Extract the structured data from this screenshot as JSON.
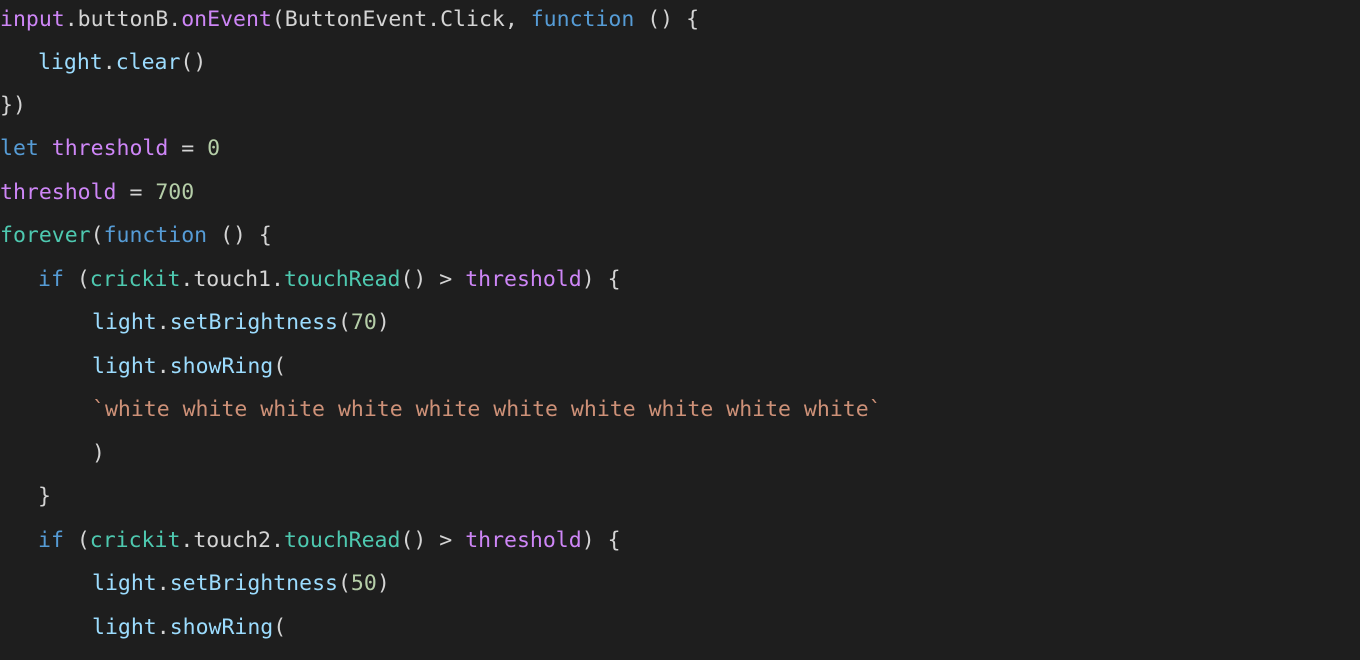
{
  "theme": {
    "background": "#1e1e1e",
    "default_text": "#d4d4d4",
    "variable": "#9cdcfe",
    "function": "#4ec9b0",
    "keyword": "#569cd6",
    "declared_var": "#ce86f7",
    "number": "#b5cea8",
    "string": "#ce9178",
    "method": "#dcdcaa"
  },
  "code_lines": [
    {
      "indent": 0,
      "tokens": [
        {
          "t": "input",
          "c": "declared_var"
        },
        {
          "t": ".buttonB.",
          "c": "default_text"
        },
        {
          "t": "onEvent",
          "c": "declared_var"
        },
        {
          "t": "(ButtonEvent.Click, ",
          "c": "default_text"
        },
        {
          "t": "function",
          "c": "keyword"
        },
        {
          "t": " () {",
          "c": "default_text"
        }
      ]
    },
    {
      "indent": 38,
      "tokens": [
        {
          "t": "light",
          "c": "variable"
        },
        {
          "t": ".",
          "c": "default_text"
        },
        {
          "t": "clear",
          "c": "variable"
        },
        {
          "t": "()",
          "c": "default_text"
        }
      ]
    },
    {
      "indent": 0,
      "tokens": [
        {
          "t": "})",
          "c": "default_text"
        }
      ]
    },
    {
      "indent": 0,
      "tokens": [
        {
          "t": "let",
          "c": "keyword"
        },
        {
          "t": " ",
          "c": "default_text"
        },
        {
          "t": "threshold",
          "c": "declared_var"
        },
        {
          "t": " = ",
          "c": "default_text"
        },
        {
          "t": "0",
          "c": "number"
        }
      ]
    },
    {
      "indent": 0,
      "tokens": [
        {
          "t": "threshold",
          "c": "declared_var"
        },
        {
          "t": " = ",
          "c": "default_text"
        },
        {
          "t": "700",
          "c": "number"
        }
      ]
    },
    {
      "indent": 0,
      "tokens": [
        {
          "t": "forever",
          "c": "function"
        },
        {
          "t": "(",
          "c": "default_text"
        },
        {
          "t": "function",
          "c": "keyword"
        },
        {
          "t": " () {",
          "c": "default_text"
        }
      ]
    },
    {
      "indent": 38,
      "tokens": [
        {
          "t": "if",
          "c": "keyword"
        },
        {
          "t": " (",
          "c": "default_text"
        },
        {
          "t": "crickit",
          "c": "function"
        },
        {
          "t": ".touch1.",
          "c": "default_text"
        },
        {
          "t": "touchRead",
          "c": "function"
        },
        {
          "t": "() > ",
          "c": "default_text"
        },
        {
          "t": "threshold",
          "c": "declared_var"
        },
        {
          "t": ") {",
          "c": "default_text"
        }
      ]
    },
    {
      "indent": 92,
      "tokens": [
        {
          "t": "light",
          "c": "variable"
        },
        {
          "t": ".",
          "c": "default_text"
        },
        {
          "t": "setBrightness",
          "c": "variable"
        },
        {
          "t": "(",
          "c": "default_text"
        },
        {
          "t": "70",
          "c": "number"
        },
        {
          "t": ")",
          "c": "default_text"
        }
      ]
    },
    {
      "indent": 92,
      "tokens": [
        {
          "t": "light",
          "c": "variable"
        },
        {
          "t": ".",
          "c": "default_text"
        },
        {
          "t": "showRing",
          "c": "variable"
        },
        {
          "t": "(",
          "c": "default_text"
        }
      ]
    },
    {
      "indent": 92,
      "tokens": [
        {
          "t": "`white white white white white white white white white white`",
          "c": "string"
        }
      ]
    },
    {
      "indent": 92,
      "tokens": [
        {
          "t": ")",
          "c": "default_text"
        }
      ]
    },
    {
      "indent": 38,
      "tokens": [
        {
          "t": "}",
          "c": "default_text"
        }
      ]
    },
    {
      "indent": 38,
      "tokens": [
        {
          "t": "if",
          "c": "keyword"
        },
        {
          "t": " (",
          "c": "default_text"
        },
        {
          "t": "crickit",
          "c": "function"
        },
        {
          "t": ".touch2.",
          "c": "default_text"
        },
        {
          "t": "touchRead",
          "c": "function"
        },
        {
          "t": "() > ",
          "c": "default_text"
        },
        {
          "t": "threshold",
          "c": "declared_var"
        },
        {
          "t": ") {",
          "c": "default_text"
        }
      ]
    },
    {
      "indent": 92,
      "tokens": [
        {
          "t": "light",
          "c": "variable"
        },
        {
          "t": ".",
          "c": "default_text"
        },
        {
          "t": "setBrightness",
          "c": "variable"
        },
        {
          "t": "(",
          "c": "default_text"
        },
        {
          "t": "50",
          "c": "number"
        },
        {
          "t": ")",
          "c": "default_text"
        }
      ]
    },
    {
      "indent": 92,
      "tokens": [
        {
          "t": "light",
          "c": "variable"
        },
        {
          "t": ".",
          "c": "default_text"
        },
        {
          "t": "showRing",
          "c": "variable"
        },
        {
          "t": "(",
          "c": "default_text"
        }
      ]
    }
  ]
}
